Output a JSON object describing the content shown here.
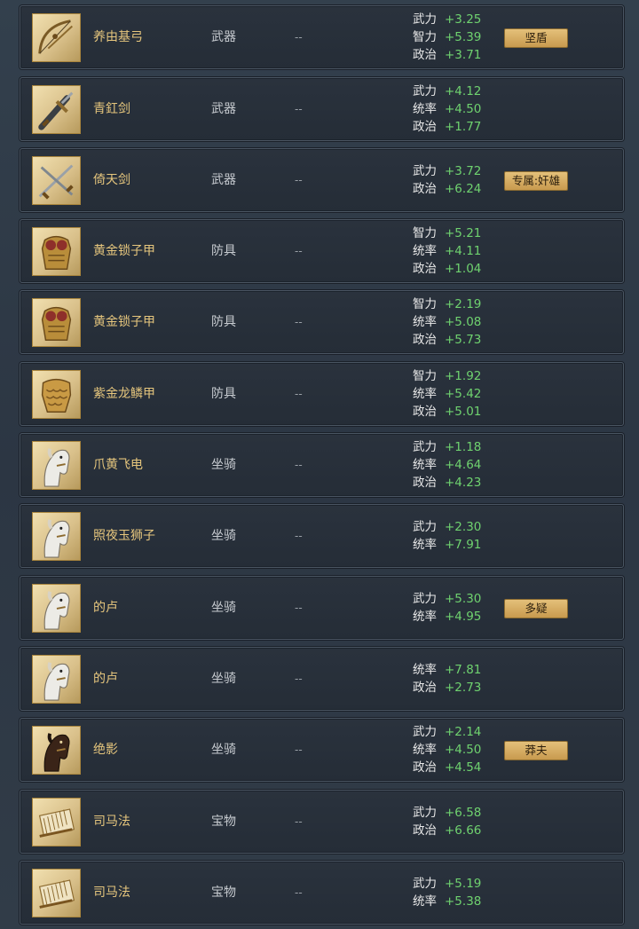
{
  "items": [
    {
      "name": "养由基弓",
      "type": "武器",
      "extra": "--",
      "icon": "bow",
      "tag": "坚盾",
      "stats": [
        {
          "label": "武力",
          "value": "+3.25"
        },
        {
          "label": "智力",
          "value": "+5.39"
        },
        {
          "label": "政治",
          "value": "+3.71"
        }
      ]
    },
    {
      "name": "青釭剑",
      "type": "武器",
      "extra": "--",
      "icon": "sword",
      "tag": null,
      "stats": [
        {
          "label": "武力",
          "value": "+4.12"
        },
        {
          "label": "统率",
          "value": "+4.50"
        },
        {
          "label": "政治",
          "value": "+1.77"
        }
      ]
    },
    {
      "name": "倚天剑",
      "type": "武器",
      "extra": "--",
      "icon": "crossed-swords",
      "tag": "专属:奸雄",
      "stats": [
        {
          "label": "武力",
          "value": "+3.72"
        },
        {
          "label": "政治",
          "value": "+6.24"
        }
      ]
    },
    {
      "name": "黄金锁子甲",
      "type": "防具",
      "extra": "--",
      "icon": "armor",
      "tag": null,
      "stats": [
        {
          "label": "智力",
          "value": "+5.21"
        },
        {
          "label": "统率",
          "value": "+4.11"
        },
        {
          "label": "政治",
          "value": "+1.04"
        }
      ]
    },
    {
      "name": "黄金锁子甲",
      "type": "防具",
      "extra": "--",
      "icon": "armor",
      "tag": null,
      "stats": [
        {
          "label": "智力",
          "value": "+2.19"
        },
        {
          "label": "统率",
          "value": "+5.08"
        },
        {
          "label": "政治",
          "value": "+5.73"
        }
      ]
    },
    {
      "name": "紫金龙鳞甲",
      "type": "防具",
      "extra": "--",
      "icon": "scale-armor",
      "tag": null,
      "stats": [
        {
          "label": "智力",
          "value": "+1.92"
        },
        {
          "label": "统率",
          "value": "+5.42"
        },
        {
          "label": "政治",
          "value": "+5.01"
        }
      ]
    },
    {
      "name": "爪黄飞电",
      "type": "坐骑",
      "extra": "--",
      "icon": "white-horse",
      "tag": null,
      "stats": [
        {
          "label": "武力",
          "value": "+1.18"
        },
        {
          "label": "统率",
          "value": "+4.64"
        },
        {
          "label": "政治",
          "value": "+4.23"
        }
      ]
    },
    {
      "name": "照夜玉狮子",
      "type": "坐骑",
      "extra": "--",
      "icon": "white-horse",
      "tag": null,
      "stats": [
        {
          "label": "武力",
          "value": "+2.30"
        },
        {
          "label": "统率",
          "value": "+7.91"
        }
      ]
    },
    {
      "name": "的卢",
      "type": "坐骑",
      "extra": "--",
      "icon": "white-horse",
      "tag": "多疑",
      "stats": [
        {
          "label": "武力",
          "value": "+5.30"
        },
        {
          "label": "统率",
          "value": "+4.95"
        }
      ]
    },
    {
      "name": "的卢",
      "type": "坐骑",
      "extra": "--",
      "icon": "white-horse",
      "tag": null,
      "stats": [
        {
          "label": "统率",
          "value": "+7.81"
        },
        {
          "label": "政治",
          "value": "+2.73"
        }
      ]
    },
    {
      "name": "绝影",
      "type": "坐骑",
      "extra": "--",
      "icon": "dark-horse",
      "tag": "莽夫",
      "stats": [
        {
          "label": "武力",
          "value": "+2.14"
        },
        {
          "label": "统率",
          "value": "+4.50"
        },
        {
          "label": "政治",
          "value": "+4.54"
        }
      ]
    },
    {
      "name": "司马法",
      "type": "宝物",
      "extra": "--",
      "icon": "scroll",
      "tag": null,
      "stats": [
        {
          "label": "武力",
          "value": "+6.58"
        },
        {
          "label": "政治",
          "value": "+6.66"
        }
      ]
    },
    {
      "name": "司马法",
      "type": "宝物",
      "extra": "--",
      "icon": "scroll",
      "tag": null,
      "stats": [
        {
          "label": "武力",
          "value": "+5.19"
        },
        {
          "label": "统率",
          "value": "+5.38"
        }
      ]
    }
  ]
}
